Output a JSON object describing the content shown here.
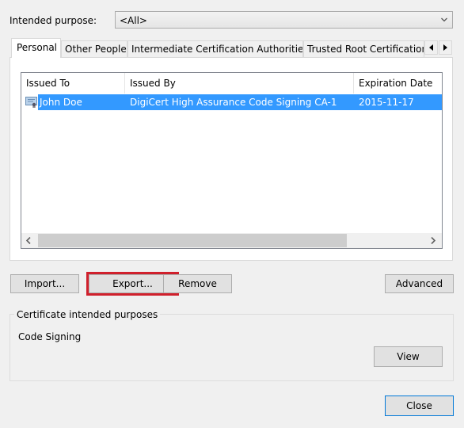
{
  "purpose": {
    "label": "Intended purpose:",
    "selected": "<All>"
  },
  "tabs": [
    {
      "label": "Personal",
      "active": true
    },
    {
      "label": "Other People",
      "active": false
    },
    {
      "label": "Intermediate Certification Authorities",
      "active": false
    },
    {
      "label": "Trusted Root Certification",
      "active": false
    }
  ],
  "list": {
    "columns": [
      "Issued To",
      "Issued By",
      "Expiration Date"
    ],
    "rows": [
      {
        "issued_to": "John Doe",
        "issued_by": "DigiCert High Assurance Code Signing CA-1",
        "expiration": "2015-11-17",
        "selected": true
      }
    ]
  },
  "buttons": {
    "import": "Import...",
    "export": "Export...",
    "remove": "Remove",
    "advanced": "Advanced",
    "view": "View",
    "close": "Close"
  },
  "purposes_group": {
    "title": "Certificate intended purposes",
    "value": "Code Signing"
  },
  "colors": {
    "selection": "#3399ff",
    "highlight_border": "#d0202c",
    "default_button_border": "#0078d7"
  }
}
